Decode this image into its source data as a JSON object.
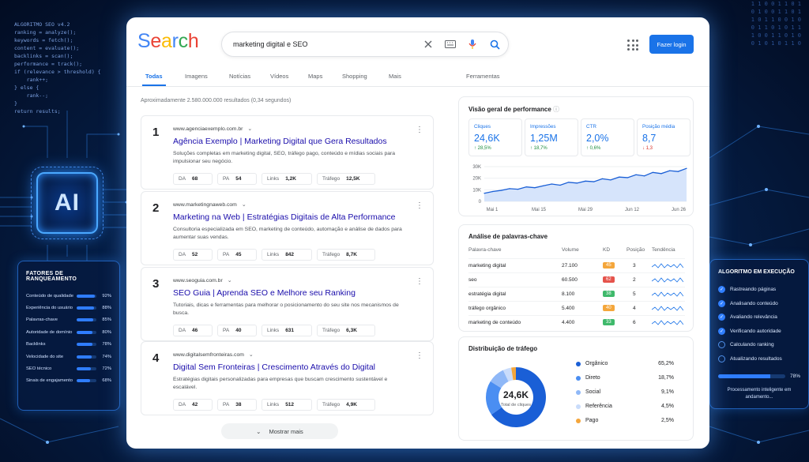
{
  "background": {
    "code_lines": [
      "ALGORITMO SEO v4.2",
      "",
      "ranking = analyze();",
      "keywords = fetch();",
      "content = evaluate();",
      "backlinks = scan();",
      "performance = track();",
      "",
      "if (relevance > threshold) {",
      "    rank++;",
      "} else {",
      "    rank--;",
      "}",
      "",
      "return results;"
    ],
    "binary": "1 1 0 0 1 1 0 1\n0 1 0 0 1 1 0 1\n1 0 1 1 0 0 1 0\n0 1 1 0 1 0 1 1\n1 0 0 1 1 0 1 0\n0 1 0 1 0 1 1 0",
    "ai_label": "AI"
  },
  "factors_panel": {
    "title": "FATORES DE RANQUEAMENTO",
    "items": [
      {
        "label": "Conteúdo de qualidade",
        "value": "92%",
        "pct": 92
      },
      {
        "label": "Experiência do usuário",
        "value": "88%",
        "pct": 88
      },
      {
        "label": "Palavras-chave",
        "value": "85%",
        "pct": 85
      },
      {
        "label": "Autoridade de domínio",
        "value": "80%",
        "pct": 80
      },
      {
        "label": "Backlinks",
        "value": "78%",
        "pct": 78
      },
      {
        "label": "Velocidade do site",
        "value": "74%",
        "pct": 74
      },
      {
        "label": "SEO técnico",
        "value": "72%",
        "pct": 72
      },
      {
        "label": "Sinais de engajamento",
        "value": "68%",
        "pct": 68
      }
    ]
  },
  "algorithm_panel": {
    "title": "ALGORITMO EM EXECUÇÃO",
    "steps": [
      {
        "label": "Rastreando páginas",
        "done": true
      },
      {
        "label": "Analisando conteúdo",
        "done": true
      },
      {
        "label": "Avaliando relevância",
        "done": true
      },
      {
        "label": "Verificando autoridade",
        "done": true
      },
      {
        "label": "Calculando ranking",
        "done": false
      },
      {
        "label": "Atualizando resultados",
        "done": false
      }
    ],
    "progress_value": "78%",
    "progress_pct": 78,
    "footer": "Processamento inteligente em andamento..."
  },
  "header": {
    "logo": "Search",
    "query": "marketing digital e SEO",
    "login": "Fazer login"
  },
  "tabs": [
    "Todas",
    "Imagens",
    "Notícias",
    "Vídeos",
    "Maps",
    "Shopping",
    "Mais",
    "Ferramentas"
  ],
  "stats": "Aproximadamente 2.580.000.000 resultados (0,34 segundos)",
  "results": [
    {
      "num": "1",
      "url": "www.agenciaexemplo.com.br",
      "title": "Agência Exemplo | Marketing Digital que Gera Resultados",
      "desc": "Soluções completas em marketing digital, SEO, tráfego pago, conteúdo e mídias sociais para impulsionar seu negócio.",
      "da": "68",
      "pa": "54",
      "links": "1,2K",
      "traffic": "12,5K"
    },
    {
      "num": "2",
      "url": "www.marketingnaweb.com",
      "title": "Marketing na Web | Estratégias Digitais de Alta Performance",
      "desc": "Consultoria especializada em SEO, marketing de conteúdo, automação e análise de dados para aumentar suas vendas.",
      "da": "52",
      "pa": "45",
      "links": "842",
      "traffic": "8,7K"
    },
    {
      "num": "3",
      "url": "www.seoguia.com.br",
      "title": "SEO Guia | Aprenda SEO e Melhore seu Ranking",
      "desc": "Tutoriais, dicas e ferramentas para melhorar o posicionamento do seu site nos mecanismos de busca.",
      "da": "46",
      "pa": "40",
      "links": "631",
      "traffic": "6,3K"
    },
    {
      "num": "4",
      "url": "www.digitalsemfronteiras.com",
      "title": "Digital Sem Fronteiras | Crescimento Através do Digital",
      "desc": "Estratégias digitais personalizadas para empresas que buscam crescimento sustentável e escalável.",
      "da": "42",
      "pa": "38",
      "links": "512",
      "traffic": "4,9K"
    }
  ],
  "metric_labels": {
    "da": "DA",
    "pa": "PA",
    "links": "Links",
    "traffic": "Tráfego"
  },
  "more_results": "Mostrar mais",
  "performance": {
    "title": "Visão geral de performance",
    "kpis": [
      {
        "label": "Cliques",
        "value": "24,6K",
        "delta": "↑ 28,5%",
        "dir": "up"
      },
      {
        "label": "Impressões",
        "value": "1,25M",
        "delta": "↑ 18,7%",
        "dir": "up"
      },
      {
        "label": "CTR",
        "value": "2,0%",
        "delta": "↑ 0,6%",
        "dir": "up"
      },
      {
        "label": "Posição média",
        "value": "8,7",
        "delta": "↓ 1,3",
        "dir": "down"
      }
    ]
  },
  "chart_data": {
    "type": "area",
    "x": [
      "Mai 1",
      "Mai 15",
      "Mai 29",
      "Jun 12",
      "Jun 26"
    ],
    "y_ticks": [
      "30K",
      "20K",
      "10K",
      "0"
    ],
    "ylim": [
      0,
      30000
    ],
    "values": [
      7000,
      8500,
      9500,
      11000,
      10500,
      12500,
      11800,
      13500,
      15000,
      14000,
      16500,
      15800,
      17500,
      17000,
      19500,
      18500,
      21000,
      20500,
      23000,
      22000,
      25000,
      24000,
      26500,
      25800,
      28500
    ]
  },
  "keywords": {
    "title": "Análise de palavras-chave",
    "headers": [
      "Palavra-chave",
      "Volume",
      "KD",
      "Posição",
      "Tendência"
    ],
    "rows": [
      {
        "kw": "marketing digital",
        "volume": "27.100",
        "kd": "45",
        "kd_color": "#f4a63b",
        "pos": "3"
      },
      {
        "kw": "seo",
        "volume": "60.500",
        "kd": "62",
        "kd_color": "#e5534b",
        "pos": "2"
      },
      {
        "kw": "estratégia digital",
        "volume": "8.100",
        "kd": "38",
        "kd_color": "#3fb96b",
        "pos": "5"
      },
      {
        "kw": "tráfego orgânico",
        "volume": "5.400",
        "kd": "40",
        "kd_color": "#f4a63b",
        "pos": "4"
      },
      {
        "kw": "marketing de conteúdo",
        "volume": "4.400",
        "kd": "33",
        "kd_color": "#3fb96b",
        "pos": "6"
      }
    ]
  },
  "traffic": {
    "title": "Distribuição de tráfego",
    "center_value": "24,6K",
    "center_label": "Total de cliques",
    "slices": [
      {
        "name": "Orgânico",
        "value": "65,2%",
        "pct": 65.2,
        "color": "#1a5fd6"
      },
      {
        "name": "Direto",
        "value": "18,7%",
        "pct": 18.7,
        "color": "#4a8ef2"
      },
      {
        "name": "Social",
        "value": "9,1%",
        "pct": 9.1,
        "color": "#8fb8f7"
      },
      {
        "name": "Referência",
        "value": "4,5%",
        "pct": 4.5,
        "color": "#c9dcfb"
      },
      {
        "name": "Pago",
        "value": "2,5%",
        "pct": 2.5,
        "color": "#f4a63b"
      }
    ]
  }
}
